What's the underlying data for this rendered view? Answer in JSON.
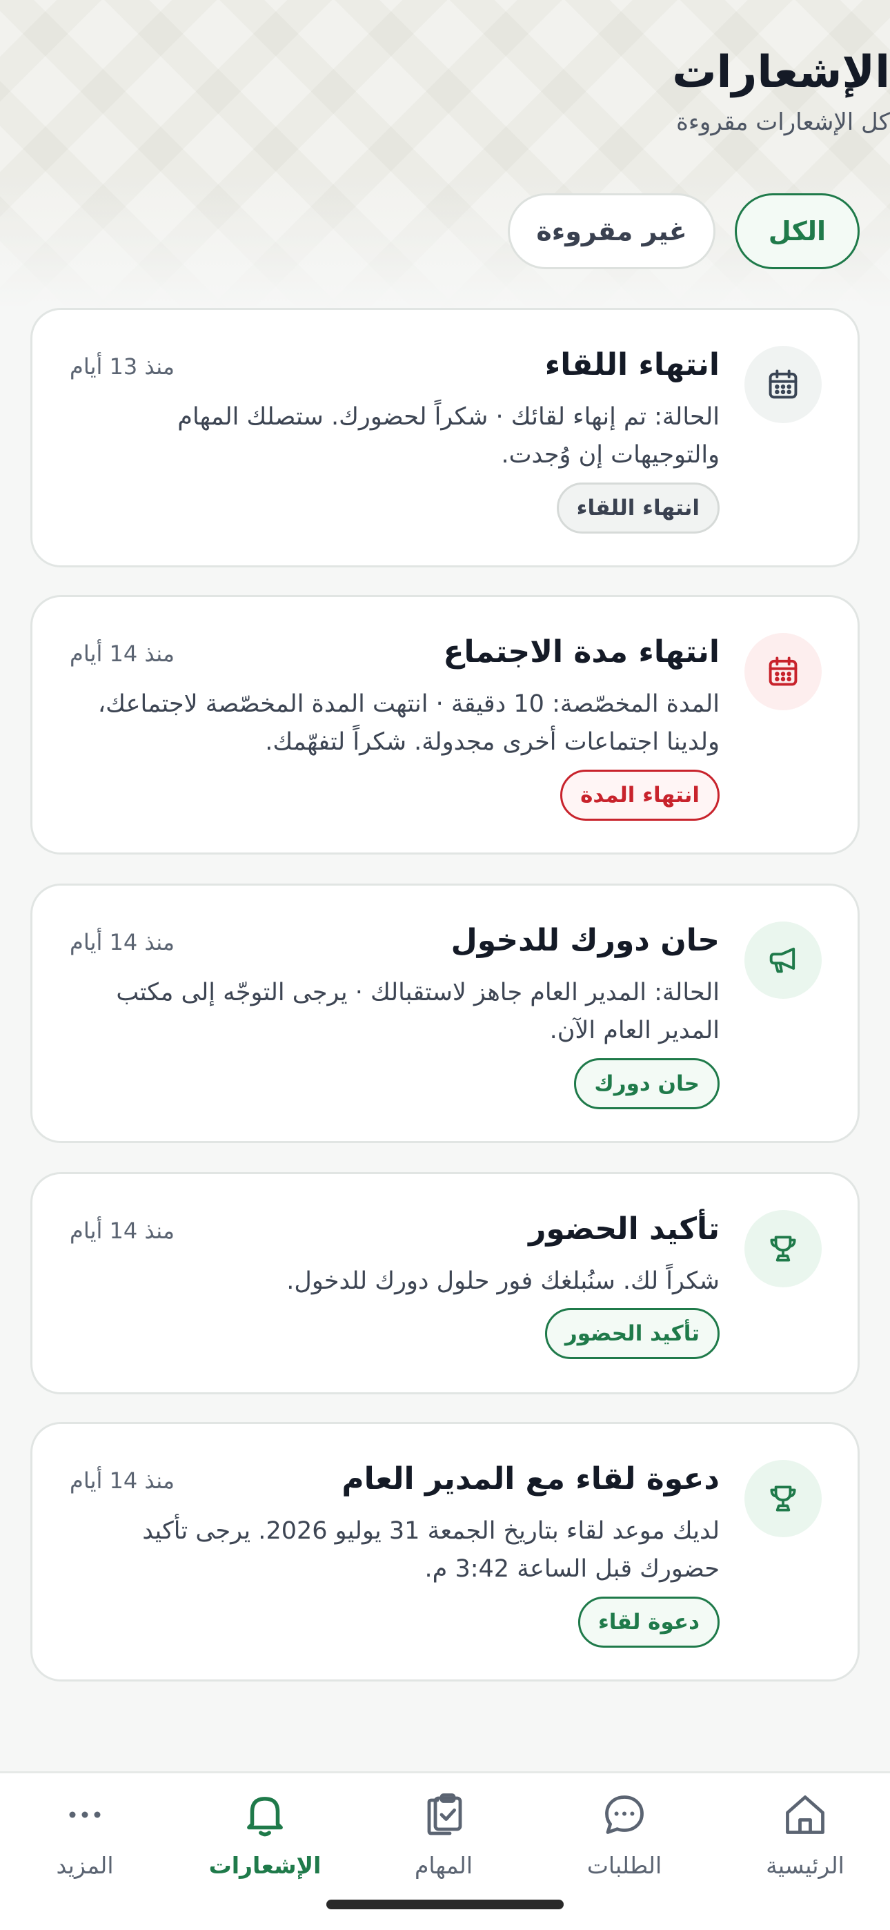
{
  "header": {
    "title": "الإشعارات",
    "subtitle": "كل الإشعارات مقروءة"
  },
  "filters": {
    "all": "الكل",
    "unread": "غير مقروءة",
    "active": "all"
  },
  "notifications": [
    {
      "title": "انتهاء اللقاء",
      "time": "منذ 13 أيام",
      "body": "الحالة: تم إنهاء لقائك · شكراً لحضورك. ستصلك المهام والتوجيهات إن وُجدت.",
      "tag": "انتهاء اللقاء",
      "icon": "calendar-icon",
      "tone": "gray"
    },
    {
      "title": "انتهاء مدة الاجتماع",
      "time": "منذ 14 أيام",
      "body": "المدة المخصّصة: 10 دقيقة · انتهت المدة المخصّصة لاجتماعك، ولدينا اجتماعات أخرى مجدولة. شكراً لتفهّمك.",
      "tag": "انتهاء المدة",
      "icon": "calendar-icon",
      "tone": "red"
    },
    {
      "title": "حان دورك للدخول",
      "time": "منذ 14 أيام",
      "body": "الحالة: المدير العام جاهز لاستقبالك · يرجى التوجّه إلى مكتب المدير العام الآن.",
      "tag": "حان دورك",
      "icon": "megaphone-icon",
      "tone": "green"
    },
    {
      "title": "تأكيد الحضور",
      "time": "منذ 14 أيام",
      "body": "شكراً لك. سنُبلغك فور حلول دورك للدخول.",
      "tag": "تأكيد الحضور",
      "icon": "trophy-icon",
      "tone": "green"
    },
    {
      "title": "دعوة لقاء مع المدير العام",
      "time": "منذ 14 أيام",
      "body": "لديك موعد لقاء بتاريخ الجمعة 31 يوليو 2026. يرجى تأكيد حضورك قبل الساعة 3:42 م.",
      "tag": "دعوة لقاء",
      "icon": "trophy-icon",
      "tone": "green"
    }
  ],
  "nav": {
    "home": "الرئيسية",
    "requests": "الطلبات",
    "tasks": "المهام",
    "notifications": "الإشعارات",
    "more": "المزيد",
    "active": "notifications"
  },
  "colors": {
    "accent": "#1f7a4a",
    "danger": "#c8232c",
    "text": "#141a26"
  }
}
